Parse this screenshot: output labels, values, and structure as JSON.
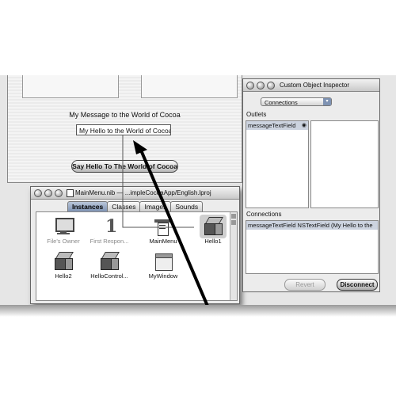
{
  "main_window": {
    "message_label": "My Message to the World of Cocoa",
    "message_field_value": "My Hello to the World of Cocoa!",
    "button_label": "Say Hello To The World of Cocoa"
  },
  "nib_window": {
    "title": "MainMenu.nib — ...impleCocoaApp/English.lproj",
    "tabs": [
      {
        "label": "Instances",
        "active": true
      },
      {
        "label": "Classes",
        "active": false
      },
      {
        "label": "Images",
        "active": false
      },
      {
        "label": "Sounds",
        "active": false
      }
    ],
    "instances": [
      {
        "label": "File's Owner",
        "icon": "files-owner-icon",
        "dim": true
      },
      {
        "label": "First Respon...",
        "icon": "first-responder-icon",
        "dim": true
      },
      {
        "label": "MainMenu",
        "icon": "menu-icon",
        "dim": false
      },
      {
        "label": "Hello1",
        "icon": "cube-icon",
        "dim": false
      },
      {
        "label": "Hello2",
        "icon": "cube-icon",
        "dim": false
      },
      {
        "label": "HelloControl...",
        "icon": "cube-icon",
        "dim": false
      },
      {
        "label": "MyWindow",
        "icon": "window-icon",
        "dim": false
      }
    ]
  },
  "inspector": {
    "title": "Custom Object Inspector",
    "popup_value": "Connections",
    "outlets_label": "Outlets",
    "outlets": [
      {
        "name": "messageTextField"
      }
    ],
    "connections_label": "Connections",
    "connections": [
      {
        "text": "messageTextField  NSTextField (My Hello to the"
      }
    ],
    "revert_label": "Revert",
    "disconnect_label": "Disconnect"
  }
}
